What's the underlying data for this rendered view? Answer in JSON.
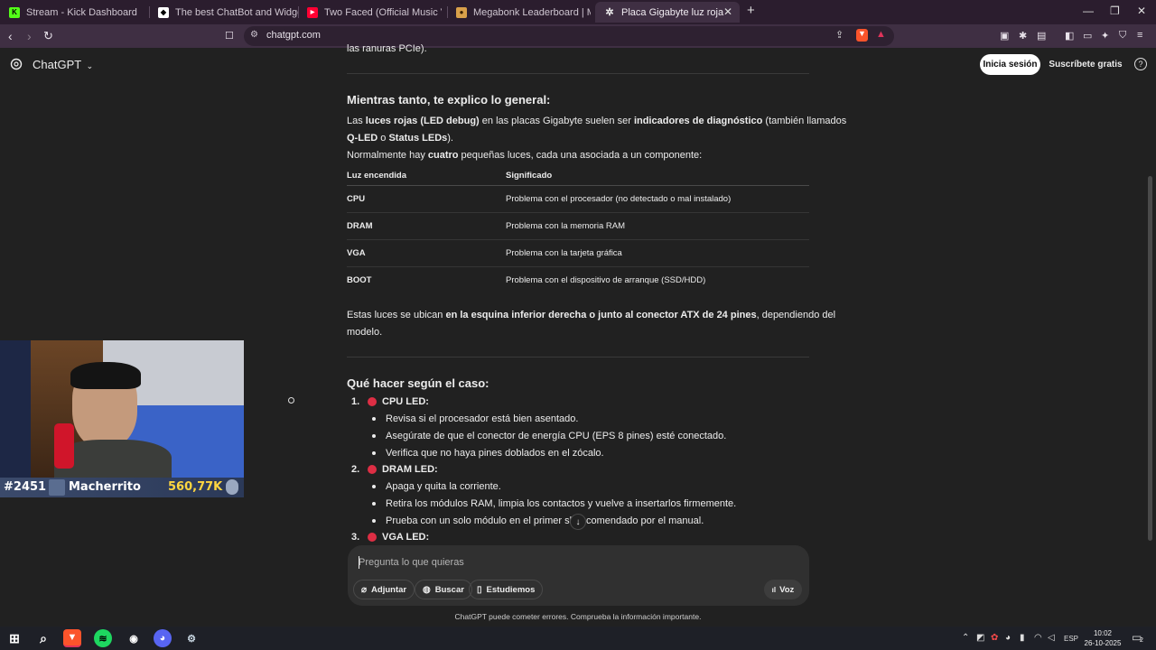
{
  "browser": {
    "tabs": [
      {
        "title": "Stream - Kick Dashboard",
        "icon": "kick-icon",
        "color": "#53fc18"
      },
      {
        "title": "The best ChatBot and Widgets for Ki",
        "icon": "botrix-icon",
        "color": "#ffffff"
      },
      {
        "title": "Two Faced (Official Music Video) - Lin",
        "icon": "youtube-icon",
        "color": "#ff0033"
      },
      {
        "title": "Megabonk Leaderboard | Megabonk",
        "icon": "megabonk-icon",
        "color": "#d9a04a"
      },
      {
        "title": "Placa Gigabyte luz roja",
        "icon": "openai-icon",
        "active": true
      }
    ],
    "url": "chatgpt.com"
  },
  "header": {
    "app_name": "ChatGPT",
    "login_label": "Inicia sesión",
    "signup_label": "Suscríbete gratis",
    "help_label": "?"
  },
  "article": {
    "top_fragment": "las ranuras PCIe).",
    "section1_heading": "Mientras tanto, te explico lo general:",
    "intro_p1": [
      "Las ",
      "luces rojas (LED debug)",
      " en las placas Gigabyte suelen ser ",
      "indicadores de diagnóstico",
      " (también llamados"
    ],
    "intro_p1b": [
      "Q-LED",
      " o ",
      "Status LEDs",
      ")."
    ],
    "intro_p2": [
      "Normalmente hay ",
      "cuatro",
      " pequeñas luces, cada una asociada a un componente:"
    ],
    "table": {
      "headers": [
        "Luz encendida",
        "Significado"
      ],
      "rows": [
        [
          "CPU",
          "Problema con el procesador (no detectado o mal instalado)"
        ],
        [
          "DRAM",
          "Problema con la memoria RAM"
        ],
        [
          "VGA",
          "Problema con la tarjeta gráfica"
        ],
        [
          "BOOT",
          "Problema con el dispositivo de arranque (SSD/HDD)"
        ]
      ]
    },
    "location_p": [
      "Estas luces se ubican ",
      "en la esquina inferior derecha o junto al conector ATX de 24 pines",
      ", dependiendo del"
    ],
    "location_p2": "modelo.",
    "section2_heading": "Qué hacer según el caso:",
    "steps": [
      {
        "num": "1.",
        "title": "CPU LED:",
        "bullets": [
          "Revisa si el procesador está bien asentado.",
          "Asegúrate de que el conector de energía CPU (EPS 8 pines) esté conectado.",
          "Verifica que no haya pines doblados en el zócalo."
        ]
      },
      {
        "num": "2.",
        "title": "DRAM LED:",
        "bullets": [
          "Apaga y quita la corriente.",
          "Retira los módulos RAM, limpia los contactos y vuelve a insertarlos firmemente.",
          "Prueba con un solo módulo en el primer slo",
          "comendado por el manual."
        ]
      },
      {
        "num": "3.",
        "title": "VGA LED:"
      }
    ]
  },
  "composer": {
    "placeholder": "Pregunta lo que quieras",
    "attach_label": "Adjuntar",
    "search_label": "Buscar",
    "study_label": "Estudiemos",
    "voice_label": "Voz",
    "disclaimer": "ChatGPT puede cometer errores. Comprueba la información importante."
  },
  "webcam": {
    "rank": "#2451",
    "username": "Macherrito",
    "score": "560,77K"
  },
  "taskbar": {
    "language": "ESP",
    "time": "10:02",
    "date": "26-10-2025",
    "notification_count": "2"
  },
  "colors": {
    "background": "#212121",
    "tabbar": "#2b1d2e",
    "red_dot": "#dd2e44"
  }
}
